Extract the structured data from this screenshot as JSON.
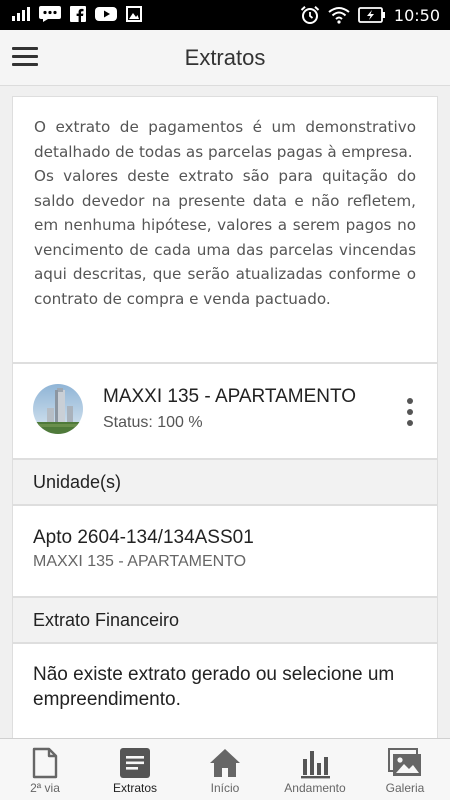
{
  "status_bar": {
    "time": "10:50",
    "icons": [
      "signal-icon",
      "chat-icon",
      "facebook-icon",
      "youtube-icon",
      "image-icon",
      "alarm-icon",
      "wifi-icon",
      "battery-icon"
    ]
  },
  "app_bar": {
    "title": "Extratos",
    "menu_icon": "menu-icon"
  },
  "intro": {
    "paragraph1": "O extrato de pagamentos é um demonstrativo detalhado de todas as parcelas pagas à empresa.",
    "paragraph2": "Os valores deste extrato são para quitação do saldo devedor na presente data e não refletem, em nenhuma hipótese, valores a serem pagos no vencimento de cada uma das parcelas vincendas aqui descritas, que serão atualizadas conforme o contrato de compra e venda pactuado."
  },
  "project": {
    "name": "MAXXI 135 - APARTAMENTO",
    "status": "Status: 100 %",
    "more_icon": "more-vert-icon"
  },
  "units_section": {
    "title": "Unidade(s)",
    "items": [
      {
        "title": "Apto 2604-134/134ASS01",
        "subtitle": "MAXXI 135 - APARTAMENTO"
      }
    ]
  },
  "financial_section": {
    "title": "Extrato Financeiro",
    "empty_message": "Não existe extrato gerado ou selecione um empreendimento."
  },
  "bottom_nav": {
    "active": "Extratos",
    "items": [
      {
        "label": "2ª via",
        "icon": "document-icon"
      },
      {
        "label": "Extratos",
        "icon": "list-icon"
      },
      {
        "label": "Início",
        "icon": "home-icon"
      },
      {
        "label": "Andamento",
        "icon": "bar-chart-icon"
      },
      {
        "label": "Galeria",
        "icon": "gallery-icon"
      }
    ]
  },
  "colors": {
    "status_bar": "#000000",
    "app_bar": "#f5f5f5",
    "background": "#f0f0f0",
    "section_header": "#f2f2f2",
    "text_primary": "#222222",
    "text_secondary": "#555555"
  }
}
